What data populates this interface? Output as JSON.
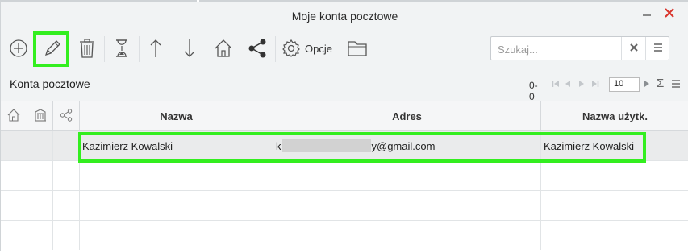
{
  "window": {
    "title": "Moje konta pocztowe",
    "minimize_icon": "minimize-icon",
    "close_icon": "close-icon",
    "close_color": "#d9342b"
  },
  "toolbar": {
    "icons": [
      "add-circle-icon",
      "pencil-edit-icon",
      "trash-icon",
      "hourglass-icon",
      "arrow-up-icon",
      "arrow-down-icon",
      "home-icon",
      "share-icon",
      "gear-icon",
      "folder-icon"
    ],
    "options_label": "Opcje",
    "highlight_color": "#33ee1f"
  },
  "search": {
    "placeholder": "Szukaj...",
    "clear_icon": "clear-x-icon",
    "menu_icon": "hamburger-icon"
  },
  "section": {
    "title": "Konta pocztowe"
  },
  "pager": {
    "range": "0-0",
    "page_size": "10",
    "sum_symbol": "Σ"
  },
  "table": {
    "icon_columns": [
      "home-icon",
      "building-icon",
      "share-icon"
    ],
    "columns": [
      "Nazwa",
      "Adres",
      "Nazwa użytk."
    ],
    "rows": [
      {
        "name": "Kazimierz Kowalski",
        "address_prefix": "k",
        "address_suffix": "y@gmail.com",
        "username": "Kazimierz Kowalski"
      }
    ],
    "empty_rows": 3
  }
}
